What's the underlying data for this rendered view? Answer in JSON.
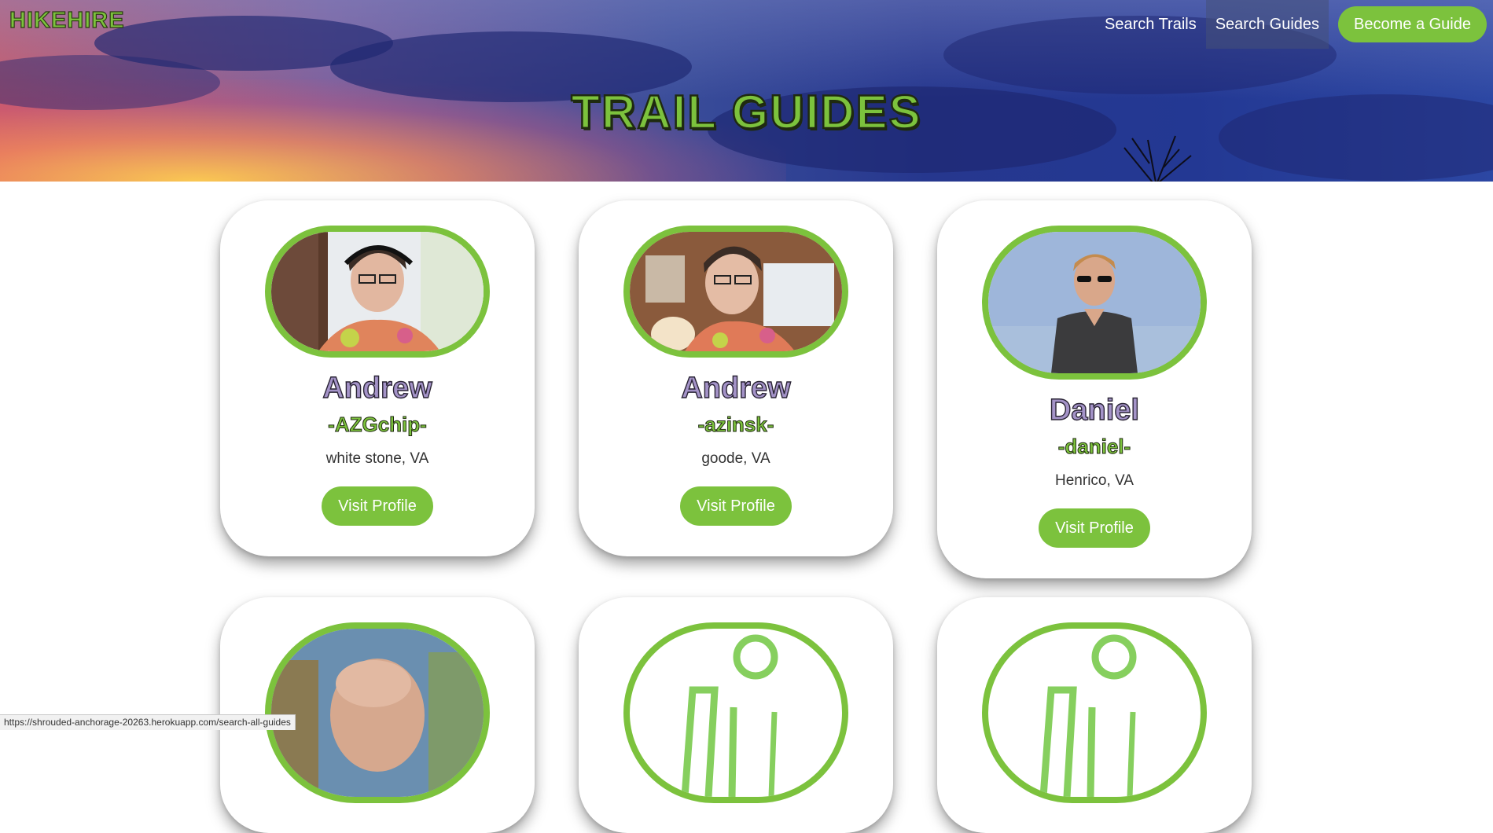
{
  "header": {
    "logo": "HIKEHIRE",
    "nav": {
      "search_trails": "Search Trails",
      "search_guides": "Search Guides",
      "become_guide": "Become a Guide"
    },
    "title": "TRAIL GUIDES"
  },
  "guides": [
    {
      "name": "Andrew",
      "username": "-AZGchip-",
      "location": "white stone, VA",
      "button": "Visit Profile"
    },
    {
      "name": "Andrew",
      "username": "-azinsk-",
      "location": "goode, VA",
      "button": "Visit Profile"
    },
    {
      "name": "Daniel",
      "username": "-daniel-",
      "location": "Henrico, VA",
      "button": "Visit Profile"
    }
  ],
  "status_bar": {
    "url": "https://shrouded-anchorage-20263.herokuapp.com/search-all-guides"
  },
  "colors": {
    "accent_green": "#7cc23d",
    "name_purple": "#a493c8"
  }
}
